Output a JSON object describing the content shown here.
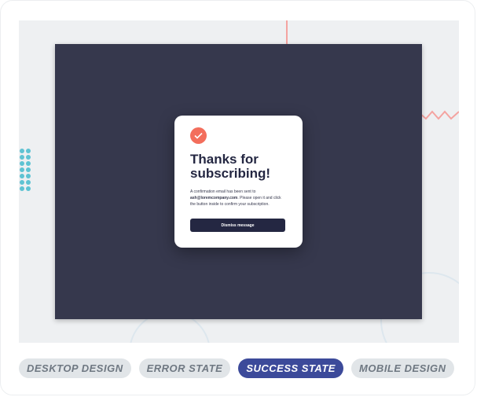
{
  "modal": {
    "title": "Thanks for subscribing!",
    "body_prefix": "A confirmation email has been sent to",
    "email": "ash@loremcompany.com",
    "body_suffix": ". Please open it and click the button inside to confirm your subscription.",
    "dismiss_label": "Dismiss message"
  },
  "tabs": [
    {
      "label": "DESKTOP DESIGN",
      "active": false
    },
    {
      "label": "ERROR STATE",
      "active": false
    },
    {
      "label": "SUCCESS STATE",
      "active": true
    },
    {
      "label": "MOBILE DESIGN",
      "active": false
    }
  ],
  "colors": {
    "accent": "#3c4a9a",
    "check": "#f36e5c",
    "overlay": "#36384d",
    "button": "#242742"
  }
}
